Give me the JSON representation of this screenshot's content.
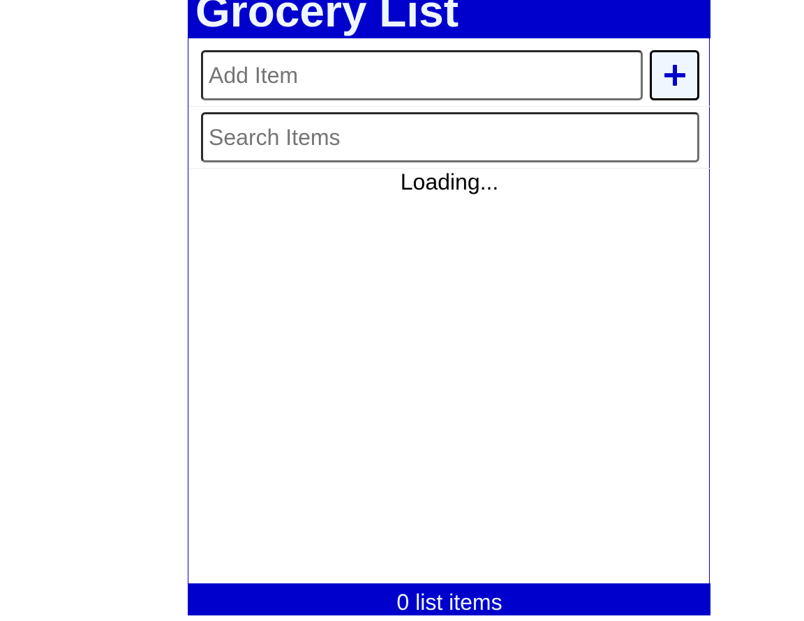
{
  "header": {
    "title": "Grocery List"
  },
  "add_form": {
    "placeholder": "Add Item",
    "value": "",
    "button_icon": "plus-icon"
  },
  "search_form": {
    "placeholder": "Search Items",
    "value": ""
  },
  "main": {
    "status_text": "Loading..."
  },
  "footer": {
    "count_text": "0 list items"
  },
  "colors": {
    "brand": "#0000cc",
    "header_text": "#eef6ff",
    "button_bg": "#f0f6ff"
  }
}
